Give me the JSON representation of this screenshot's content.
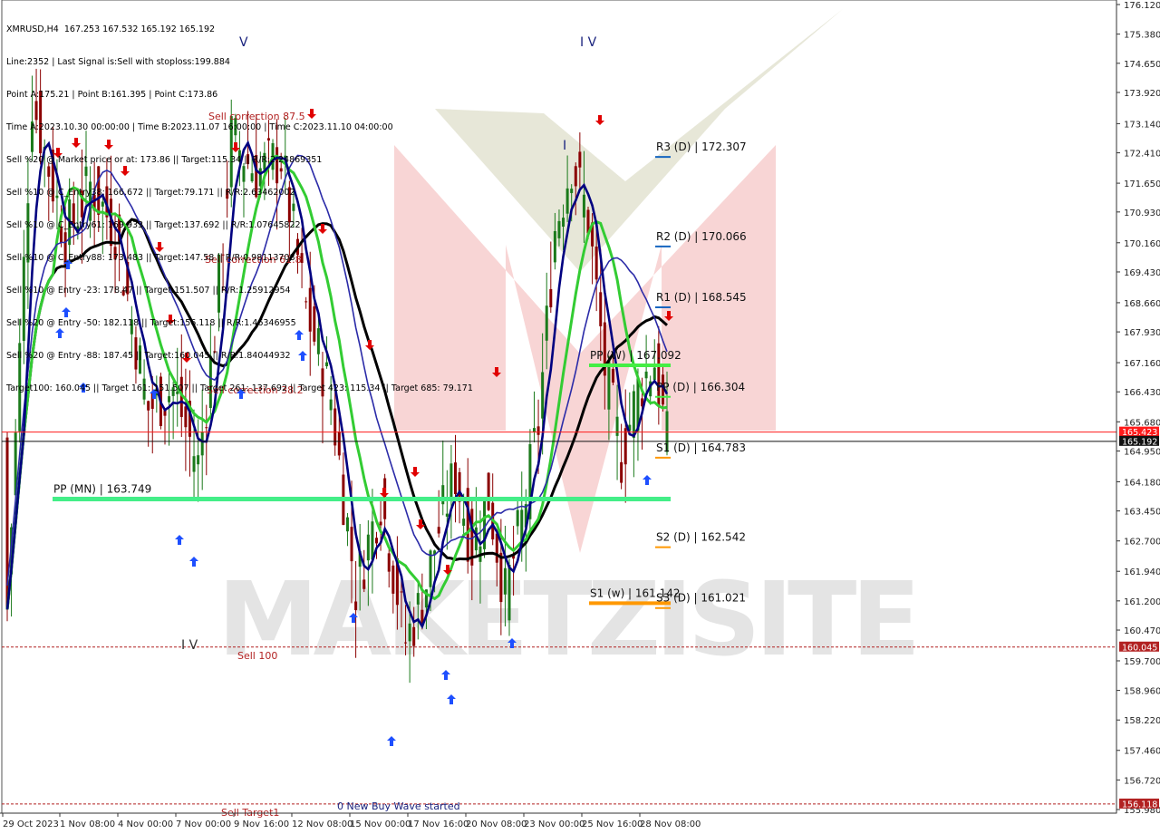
{
  "chart_data": {
    "type": "candlestick",
    "symbol": "XMRUSD,H4",
    "ohlc_header": "XMRUSD,H4  167.253 167.532 165.192 165.192",
    "info_lines": [
      "Line:2352 | Last Signal is:Sell with stoploss:199.884",
      "Point A:175.21 | Point B:161.395 | Point C:173.86",
      "Time A:2023.10.30 00:00:00 | Time B:2023.11.07 16:00:00 | Time C:2023.11.10 04:00:00",
      "Sell %20 @ Market price or at: 173.86 || Target:115.34 || R/R:2.24869351",
      "Sell %10 @ C_Entry38: 166.672 || Target:79.171 || R/R:2.63462002",
      "Sell %10 @ C_Entry61: 169.933 || Target:137.692 || R/R:1.07645822",
      "Sell %10 @ C_Entry88: 173.483 || Target:147.58 || R/R:0.98113708",
      "Sell %10 @ Entry -23: 178.47 || Target:151.507 || R/R:1.25912954",
      "Sell %20 @ Entry -50: 182.118 || Target:156.118 || R/R:1.46346955",
      "Sell %20 @ Entry -88: 187.45 || Target:160.045 || R/R:1.84044932",
      "Target100: 160.045 || Target 161: 151.507 || Target 261: 137.692 || Target 423: 115.34 || Target 685: 79.171"
    ],
    "y_ticks": [
      "176.120",
      "175.380",
      "174.650",
      "173.920",
      "173.140",
      "172.410",
      "171.650",
      "170.930",
      "170.160",
      "169.430",
      "168.660",
      "167.930",
      "167.160",
      "166.430",
      "165.680",
      "164.950",
      "164.180",
      "163.450",
      "162.700",
      "161.940",
      "161.200",
      "160.470",
      "159.700",
      "158.960",
      "158.220",
      "157.460",
      "156.720",
      "155.980"
    ],
    "y_range": [
      155.98,
      176.12
    ],
    "x_ticks": [
      "29 Oct 2023",
      "1 Nov 08:00",
      "4 Nov 00:00",
      "7 Nov 00:00",
      "9 Nov 16:00",
      "12 Nov 08:00",
      "15 Nov 00:00",
      "17 Nov 16:00",
      "20 Nov 08:00",
      "23 Nov 00:00",
      "25 Nov 16:00",
      "28 Nov 08:00"
    ],
    "price_tags": [
      {
        "label": "165.423",
        "value": 165.423,
        "color": "#ff1a1a"
      },
      {
        "label": "165.192",
        "value": 165.192,
        "color": "#111111"
      },
      {
        "label": "160.045",
        "value": 160.045,
        "color": "#b22222"
      },
      {
        "label": "156.118",
        "value": 156.118,
        "color": "#b22222"
      }
    ],
    "pivot_levels": [
      {
        "label": "R3 (D) | 172.307",
        "value": 172.307,
        "color": "#1565c0"
      },
      {
        "label": "R2 (D) | 170.066",
        "value": 170.066,
        "color": "#1565c0"
      },
      {
        "label": "R1 (D) | 168.545",
        "value": 168.545,
        "color": "#1565c0"
      },
      {
        "label": "PP (W) | 167.092",
        "value": 167.092,
        "color": "#44ee44"
      },
      {
        "label": "PP (D) | 166.304",
        "value": 166.304,
        "color": "#44ee44"
      },
      {
        "label": "S1 (D) | 164.783",
        "value": 164.783,
        "color": "#ff9800"
      },
      {
        "label": "PP (MN) | 163.749",
        "value": 163.749,
        "color": "#44ee88"
      },
      {
        "label": "S2 (D) | 162.542",
        "value": 162.542,
        "color": "#ff9800"
      },
      {
        "label": "S1 (w) | 161.142",
        "value": 161.142,
        "color": "#ff9800"
      },
      {
        "label": "S3 (D) | 161.021",
        "value": 161.021,
        "color": "#ff9800"
      }
    ],
    "annotations": [
      {
        "text": "Sell correction 87.5",
        "color": "#b22222"
      },
      {
        "text": "Sell correction 61.8",
        "color": "#b22222"
      },
      {
        "text": "Sell correction 38.2",
        "color": "#b22222"
      },
      {
        "text": "Sell 100",
        "color": "#b22222"
      },
      {
        "text": "Sell Target1",
        "color": "#b22222"
      },
      {
        "text": "0 New Buy Wave started",
        "color": "#1a237e"
      },
      {
        "text": "I V",
        "color": "#333333"
      },
      {
        "text": "I V",
        "color": "#1a237e"
      },
      {
        "text": "V",
        "color": "#1a237e"
      },
      {
        "text": "I",
        "color": "#1a237e"
      }
    ],
    "watermark": "MAKETZISITE",
    "colors": {
      "bull": "#1b7a1b",
      "bear": "#8b0000",
      "fast_ma": "#000080",
      "mid_ma": "#2b2ba8",
      "green_ma": "#33cc33",
      "slow_ma": "#000000"
    }
  }
}
